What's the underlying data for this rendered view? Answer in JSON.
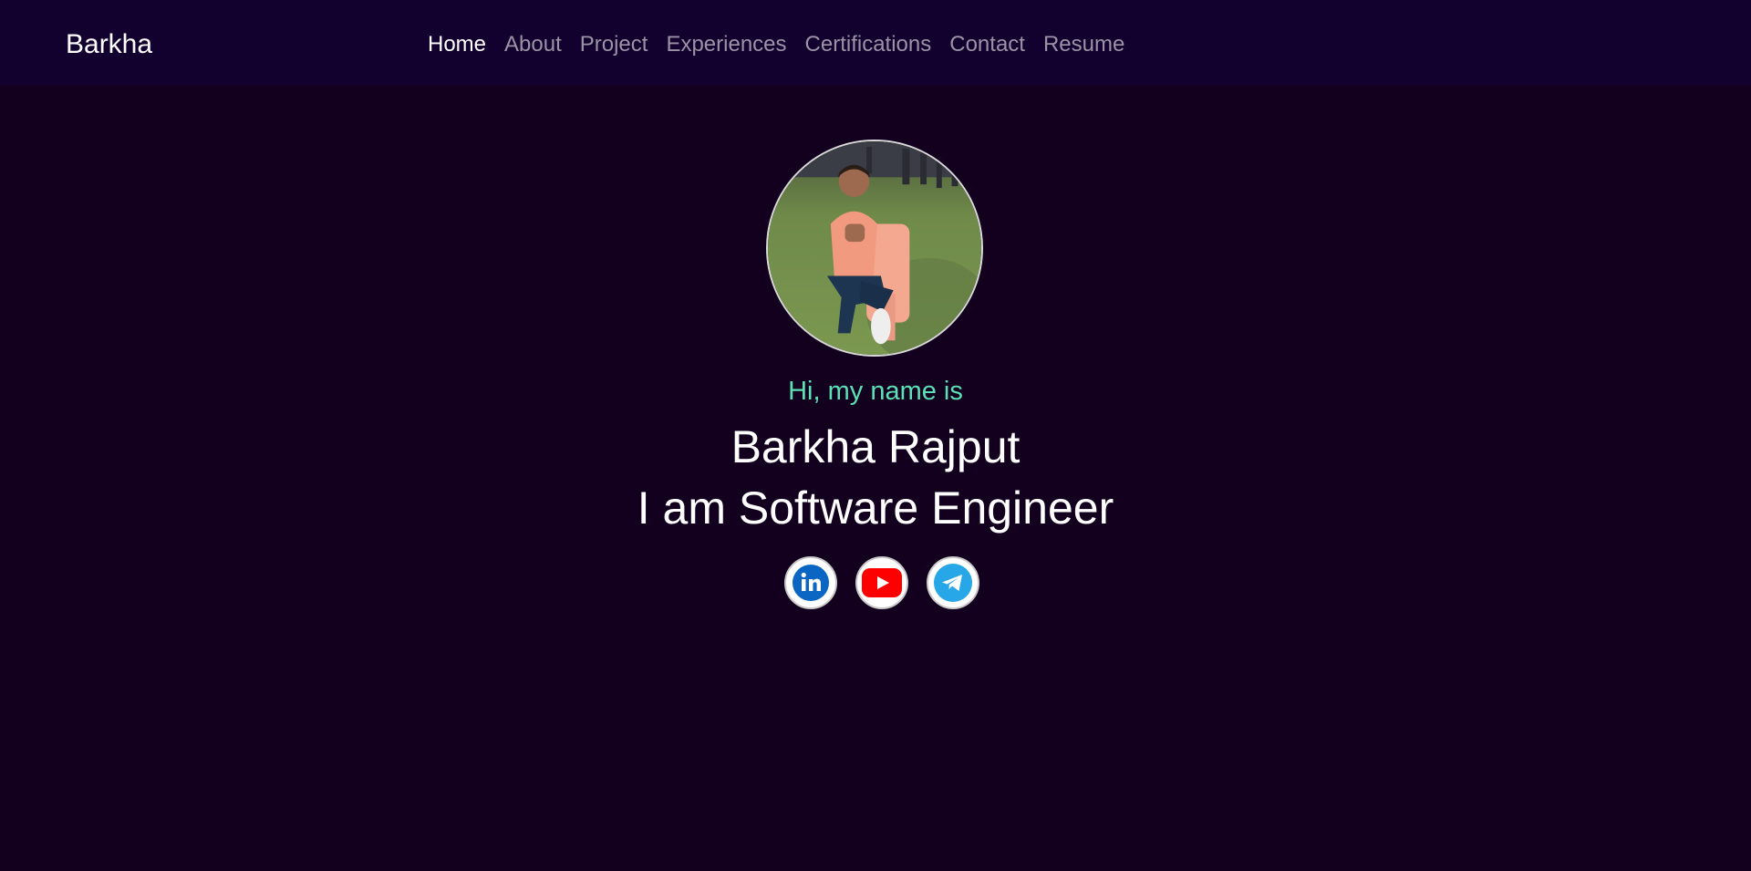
{
  "navbar": {
    "brand": "Barkha",
    "links": [
      {
        "label": "Home",
        "active": true
      },
      {
        "label": "About",
        "active": false
      },
      {
        "label": "Project",
        "active": false
      },
      {
        "label": "Experiences",
        "active": false
      },
      {
        "label": "Certifications",
        "active": false
      },
      {
        "label": "Contact",
        "active": false
      },
      {
        "label": "Resume",
        "active": false
      }
    ]
  },
  "hero": {
    "greeting": "Hi, my name is",
    "name": "Barkha Rajput",
    "role": "I am Software Engineer",
    "avatar_icon": "profile-photo",
    "socials": [
      {
        "icon": "linkedin-icon",
        "color": "#0a66c2"
      },
      {
        "icon": "youtube-icon",
        "color": "#ff0000"
      },
      {
        "icon": "telegram-icon",
        "color": "#27a7e7"
      }
    ]
  },
  "colors": {
    "background": "#13001f",
    "navbar": "#12002e",
    "greeting": "#5ce1b5",
    "nav_inactive": "#9a93a6",
    "nav_active": "#ffffff"
  }
}
